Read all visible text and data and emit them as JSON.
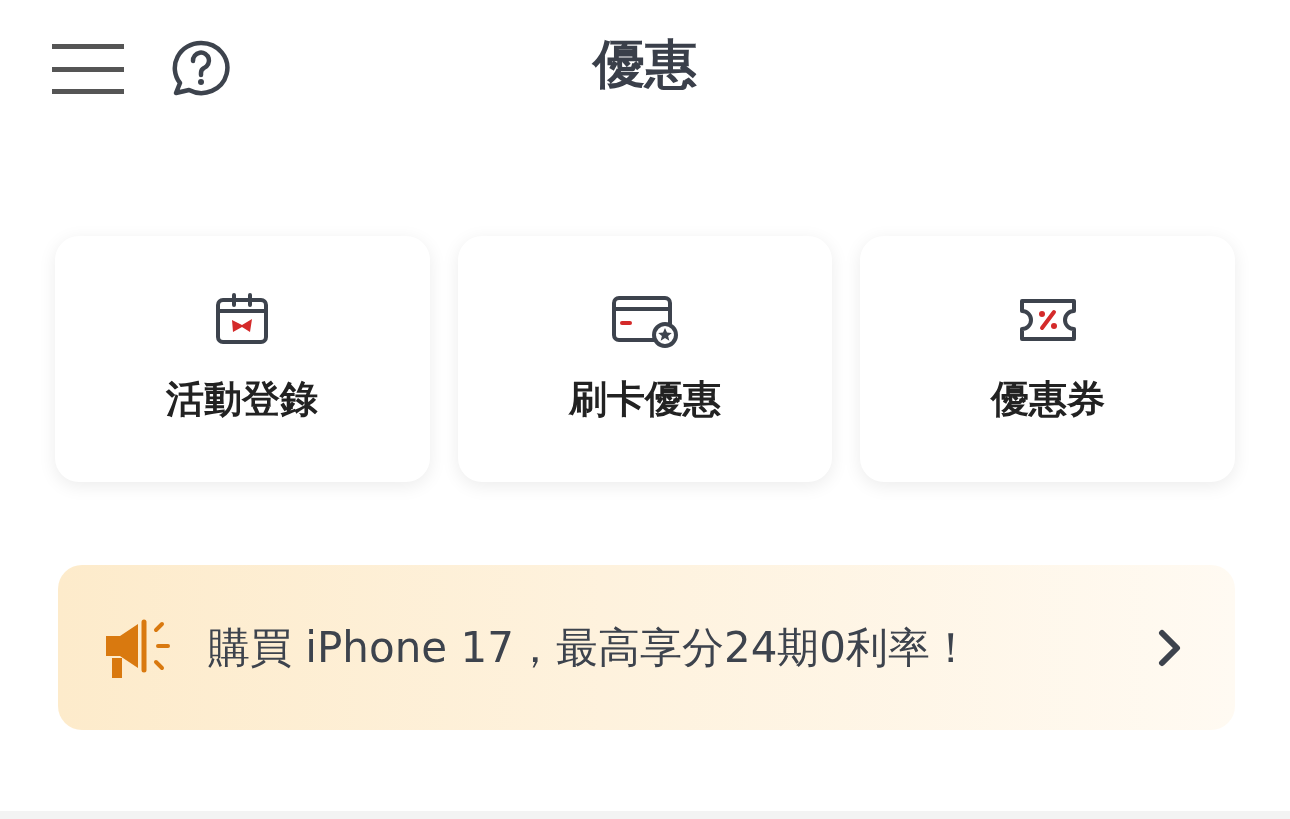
{
  "header": {
    "title": "優惠"
  },
  "shortcuts": [
    {
      "kind": "calendar",
      "label": "活動登錄"
    },
    {
      "kind": "card",
      "label": "刷卡優惠"
    },
    {
      "kind": "coupon",
      "label": "優惠券"
    }
  ],
  "banner": {
    "text": "購買 iPhone 17，最高享分24期0利率！"
  }
}
